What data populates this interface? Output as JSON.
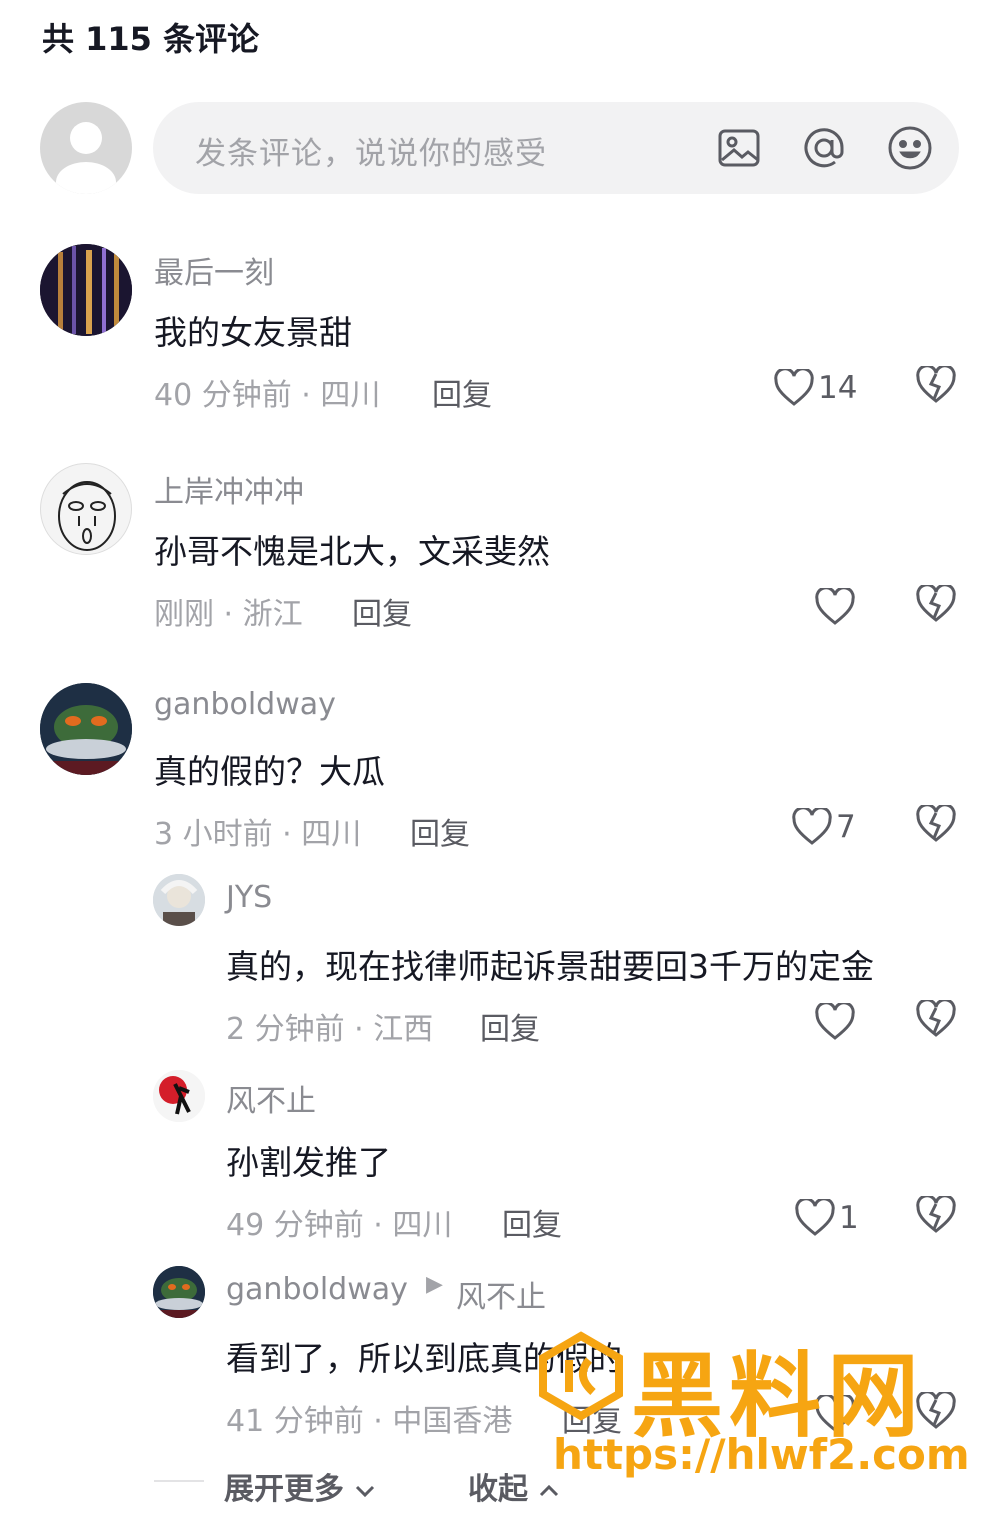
{
  "header": {
    "title": "共 115 条评论"
  },
  "composer": {
    "placeholder": "发条评论，说说你的感受",
    "icons": [
      "image-icon",
      "at-icon",
      "emoji-icon"
    ]
  },
  "comments": [
    {
      "user": "最后一刻",
      "text": "我的女友景甜",
      "meta": "40 分钟前 · 四川",
      "reply": "回复",
      "likes": "14"
    },
    {
      "user": "上岸冲冲冲",
      "text": "孙哥不愧是北大，文采斐然",
      "meta": "刚刚 · 浙江",
      "reply": "回复",
      "likes": ""
    },
    {
      "user": "ganboldway",
      "text": "真的假的？大瓜",
      "meta": "3 小时前 · 四川",
      "reply": "回复",
      "likes": "7"
    }
  ],
  "replies": [
    {
      "user": "JYS",
      "to": "",
      "text": "真的，现在找律师起诉景甜要回3千万的定金",
      "meta": "2 分钟前 · 江西",
      "reply": "回复",
      "likes": ""
    },
    {
      "user": "风不止",
      "to": "",
      "text": "孙割发推了",
      "meta": "49 分钟前 · 四川",
      "reply": "回复",
      "likes": "1"
    },
    {
      "user": "ganboldway",
      "to": "风不止",
      "text": "看到了，所以到底真的假的",
      "meta": "41 分钟前 · 中国香港",
      "reply": "回复",
      "likes": ""
    }
  ],
  "footer": {
    "expand": "展开更多",
    "collapse": "收起"
  },
  "watermark": {
    "brand": "黑料网",
    "url": "https://hlwf2.com"
  },
  "colors": {
    "text": "#161823",
    "secondary": "#8a8b91",
    "watermark": "#f6a512"
  }
}
